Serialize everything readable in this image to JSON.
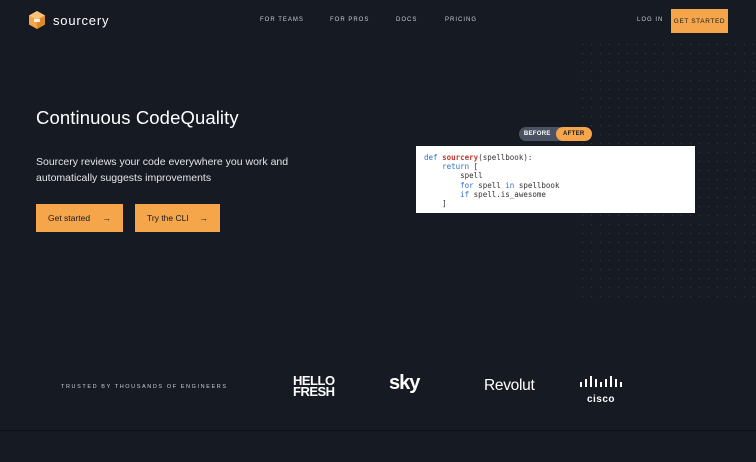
{
  "nav": {
    "brand": "sourcery",
    "links": [
      "FOR TEAMS",
      "FOR PROS",
      "DOCS",
      "PRICING"
    ],
    "login": "LOG IN",
    "get_started": "GET STARTED"
  },
  "hero": {
    "title": "Continuous CodeQuality",
    "subtitle": "Sourcery reviews your code everywhere you work and automatically suggests improvements",
    "cta_primary": "Get started",
    "cta_secondary": "Try the CLI",
    "arrow_glyph": "→"
  },
  "toggle": {
    "before": "BEFORE",
    "after": "AFTER",
    "selected": "AFTER"
  },
  "code": {
    "lines": [
      {
        "indent": "",
        "kw": "def ",
        "fn": "sourcery",
        "rest": "(spellbook):"
      },
      {
        "indent": "    ",
        "kw": "return",
        "fn": "",
        "rest": " ["
      },
      {
        "indent": "        ",
        "kw": "",
        "fn": "",
        "rest": "spell"
      },
      {
        "indent": "        ",
        "kw": "for",
        "fn": "",
        "rest": " spell ",
        "kw2": "in",
        "rest2": " spellbook"
      },
      {
        "indent": "        ",
        "kw": "if",
        "fn": "",
        "rest": " spell.is_awesome"
      },
      {
        "indent": "    ",
        "kw": "",
        "fn": "",
        "rest": "]"
      }
    ]
  },
  "trusted": {
    "label": "TRUSTED BY THOUSANDS OF ENGINEERS",
    "logos": {
      "hellofresh_line1": "HELLO",
      "hellofresh_line2": "FRESH",
      "sky": "sky",
      "revolut": "Revolut",
      "cisco": "cisco"
    }
  },
  "colors": {
    "background": "#161a22",
    "accent": "#f5a54a",
    "code_bg": "#ffffff",
    "keyword": "#2b6fd6",
    "function": "#c0392b"
  }
}
